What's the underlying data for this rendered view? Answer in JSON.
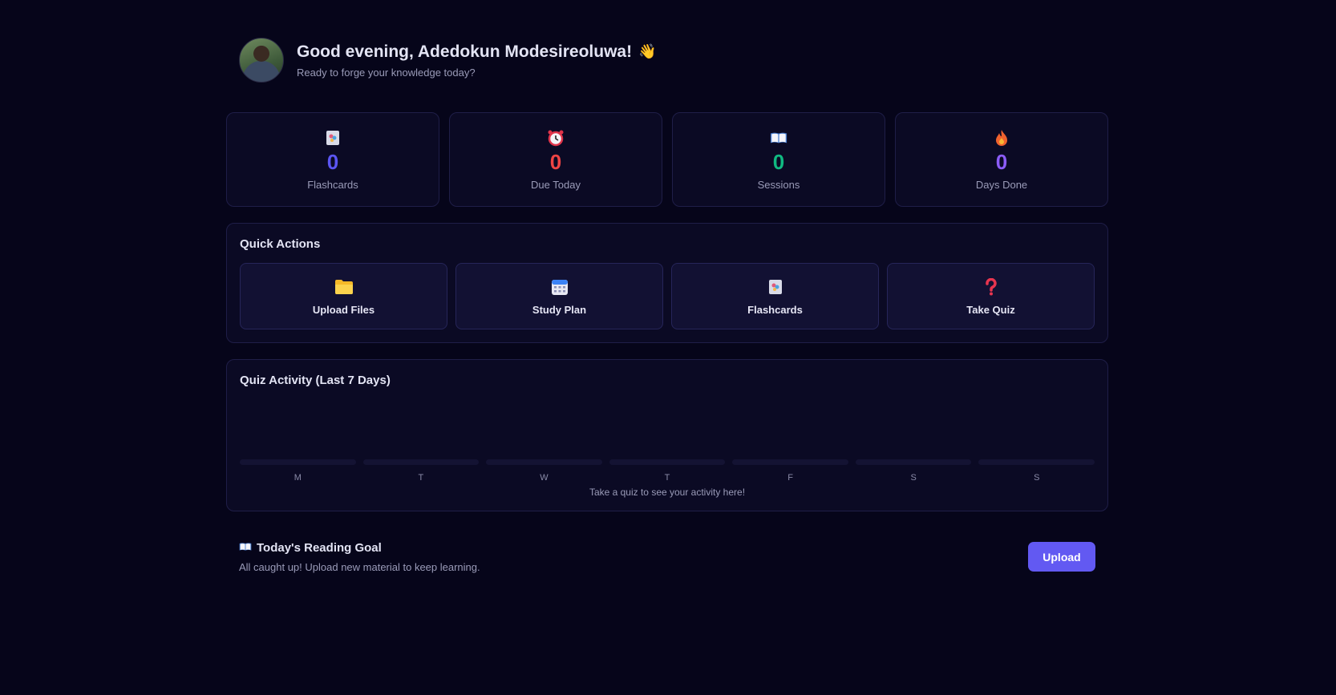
{
  "header": {
    "greeting": "Good evening, Adedokun Modesireoluwa!",
    "subtitle": "Ready to forge your knowledge today?",
    "wave_emoji": "👋"
  },
  "stats": [
    {
      "icon": "flashcards-icon",
      "value": "0",
      "label": "Flashcards",
      "color": "#5b55f2"
    },
    {
      "icon": "alarm-clock-icon",
      "value": "0",
      "label": "Due Today",
      "color": "#ef4444"
    },
    {
      "icon": "open-book-icon",
      "value": "0",
      "label": "Sessions",
      "color": "#10b981"
    },
    {
      "icon": "fire-icon",
      "value": "0",
      "label": "Days Done",
      "color": "#8b5cf6"
    }
  ],
  "quick_actions": {
    "title": "Quick Actions",
    "items": [
      {
        "icon": "folder-icon",
        "label": "Upload Files"
      },
      {
        "icon": "calendar-icon",
        "label": "Study Plan"
      },
      {
        "icon": "flashcards-icon",
        "label": "Flashcards"
      },
      {
        "icon": "question-mark-icon",
        "label": "Take Quiz"
      }
    ]
  },
  "activity": {
    "title": "Quiz Activity (Last 7 Days)",
    "days": [
      "M",
      "T",
      "W",
      "T",
      "F",
      "S",
      "S"
    ],
    "values": [
      0,
      0,
      0,
      0,
      0,
      0,
      0
    ],
    "empty_text": "Take a quiz to see your activity here!"
  },
  "reading_goal": {
    "icon": "open-book-icon",
    "title": "Today's Reading Goal",
    "subtitle": "All caught up! Upload new material to keep learning.",
    "button_label": "Upload"
  },
  "colors": {
    "background": "#06051a",
    "card": "#0b0a24",
    "accent": "#6259f2"
  }
}
